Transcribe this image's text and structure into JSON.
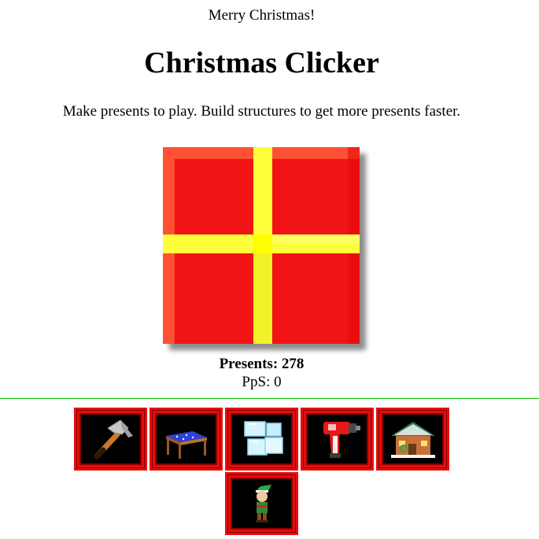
{
  "header": {
    "greeting": "Merry Christmas!",
    "title": "Christmas Clicker",
    "subtitle": "Make presents to play. Build structures to get more presents faster."
  },
  "present": {
    "icon": "present-icon"
  },
  "stats": {
    "presents_text": "Presents: 278",
    "presents": 278,
    "pps_text": "PpS: 0",
    "pps": 0
  },
  "store": {
    "items": [
      {
        "icon": "hammer-icon"
      },
      {
        "icon": "workbench-icon"
      },
      {
        "icon": "ice-blocks-icon"
      },
      {
        "icon": "drill-icon"
      },
      {
        "icon": "workshop-house-icon"
      },
      {
        "icon": "elf-icon"
      }
    ]
  },
  "colors": {
    "present_red": "#f01414",
    "ribbon_yellow": "#ffff3c",
    "tile_border": "#e80c0c",
    "divider": "#00c000"
  }
}
